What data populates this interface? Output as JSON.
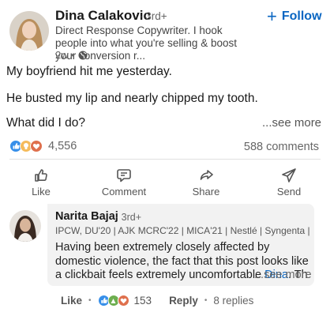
{
  "post": {
    "author": {
      "name": "Dina Calakovic",
      "degree": "· 3rd+",
      "headline": "Direct Response Copywriter. I hook people into what you're selling & boost your conversion r...",
      "time": "2w •"
    },
    "follow_label": "Follow",
    "lines": [
      "My boyfriend hit me yesterday.",
      "He busted my lip and nearly chipped my tooth.",
      "What did I do?"
    ],
    "see_more": "...see more",
    "reaction_count": "4,556",
    "comments_count": "588 comments",
    "actions": {
      "like": "Like",
      "comment": "Comment",
      "share": "Share",
      "send": "Send"
    }
  },
  "comment": {
    "author": {
      "name": "Narita Bajaj",
      "degree": "· 3rd+",
      "headline": "IPCW, DU'20 | AJK MCRC'22 | MICA'21 | Nestlé | Syngenta |..."
    },
    "text_before": "Having been extremely closely affected by domestic violence, the fact that this post looks like a clickbait feels extremely uncomfortable ",
    "mention": "Dina",
    "text_after": ". Th",
    "see_more": "...see more",
    "like_label": "Like",
    "reaction_count": "153",
    "reply_label": "Reply",
    "replies": "8 replies"
  },
  "colors": {
    "accent": "#0a66c2",
    "like_blue": "#378fe9",
    "celebrate_green": "#44712e",
    "love_red": "#df704d",
    "insight_yellow": "#f5bb5c"
  },
  "icons": [
    "globe-icon",
    "plus-icon",
    "like-reaction-icon",
    "insightful-reaction-icon",
    "love-reaction-icon",
    "thumb-up-icon",
    "comment-icon",
    "share-arrow-icon",
    "send-icon"
  ]
}
